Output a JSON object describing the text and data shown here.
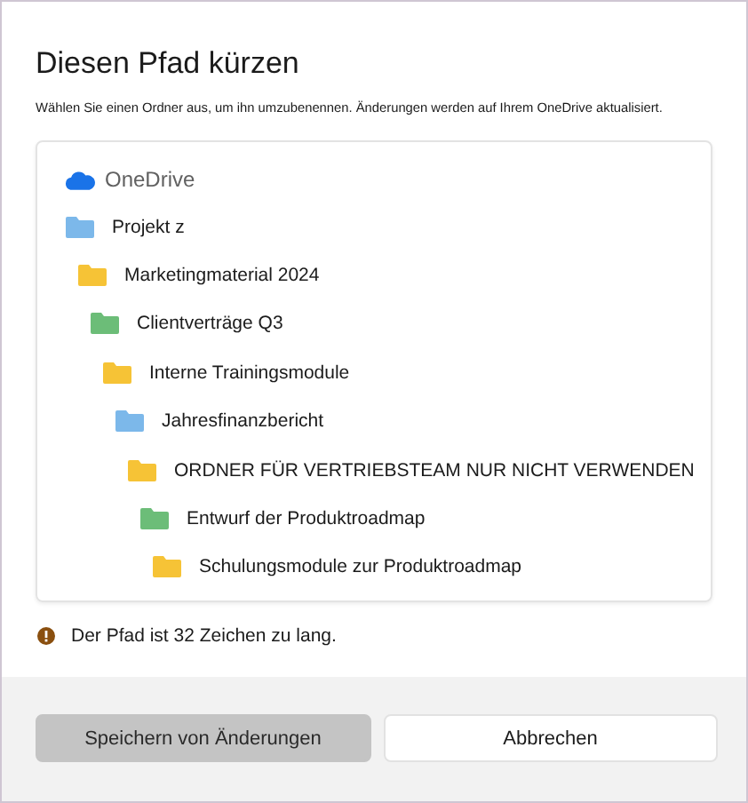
{
  "dialog": {
    "title": "Diesen Pfad kürzen",
    "description": "Wählen Sie einen Ordner aus, um ihn umzubenennen. Änderungen werden auf Ihrem OneDrive aktualisiert."
  },
  "tree": {
    "root": "OneDrive",
    "folders": [
      {
        "name": "Projekt z",
        "color": "#7cb8ea",
        "children": [
          {
            "name": "Marketingmaterial 2024",
            "color": "#f6c336",
            "children": [
              {
                "name": "Clientverträge Q3",
                "color": "#6cbd78",
                "children": [
                  {
                    "name": "Interne Trainingsmodule",
                    "color": "#f6c336",
                    "children": [
                      {
                        "name": "Jahresfinanzbericht",
                        "color": "#7cb8ea",
                        "children": [
                          {
                            "name": "ORDNER FÜR VERTRIEBSTEAM NUR NICHT VERWENDEN",
                            "color": "#f6c336",
                            "children": [
                              {
                                "name": "Entwurf der Produktroadmap",
                                "color": "#6cbd78",
                                "children": [
                                  {
                                    "name": "Schulungsmodule zur Produktroadmap",
                                    "color": "#f6c336"
                                  }
                                ]
                              }
                            ]
                          }
                        ]
                      }
                    ]
                  }
                ]
              }
            ]
          }
        ]
      }
    ]
  },
  "error": "Der Pfad ist 32 Zeichen zu lang.",
  "buttons": [
    {
      "label": "Speichern von Änderungen",
      "disabled": true
    },
    {
      "label": "Abbrechen",
      "disabled": false
    }
  ]
}
